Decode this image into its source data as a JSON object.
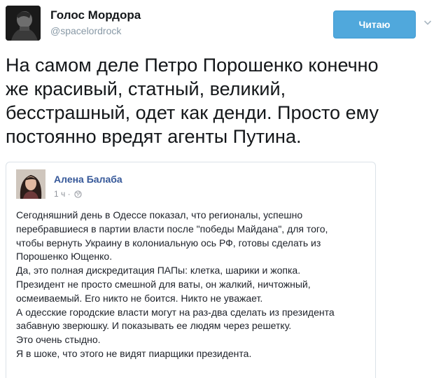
{
  "tweet": {
    "author": {
      "display_name": "Голос Мордора",
      "handle": "@spacelordrock"
    },
    "follow_button_label": "Читаю",
    "text_lines": [
      "На самом деле Петро Порошенко конечно",
      "же красивый, статный, великий,",
      "бесстрашный, одет как денди. Просто ему",
      "постоянно вредят агенты Путина."
    ]
  },
  "quoted_post": {
    "author_name": "Алена Балаба",
    "time": "1 ч ·",
    "body_lines": [
      "Сегодняшний день в Одессе показал, что регионалы, успешно",
      "перебравшиеся в партии власти после \"победы Майдана\", для того,",
      "чтобы вернуть Украину в колониальную ось РФ, готовы сделать из",
      "Порошенко Ющенко.",
      "Да, это полная дискредитация ПАПы: клетка, шарики и жопка.",
      "Президент не просто смешной для ваты, он жалкий, ничтожный,",
      "осмеиваемый. Его никто не боится. Никто не уважает.",
      "А одесские городские власти могут на раз-два сделать из президента",
      "забавную зверюшку. И показывать ее людям через решетку.",
      "Это очень стыдно.",
      "Я в шоке, что этого не видят пиарщики президента."
    ]
  },
  "icons": {
    "caret": "chevron-down-icon",
    "privacy": "globe-icon"
  },
  "colors": {
    "follow_button": "#50a8dc",
    "author_link": "#365899",
    "handle": "#8899a6"
  }
}
